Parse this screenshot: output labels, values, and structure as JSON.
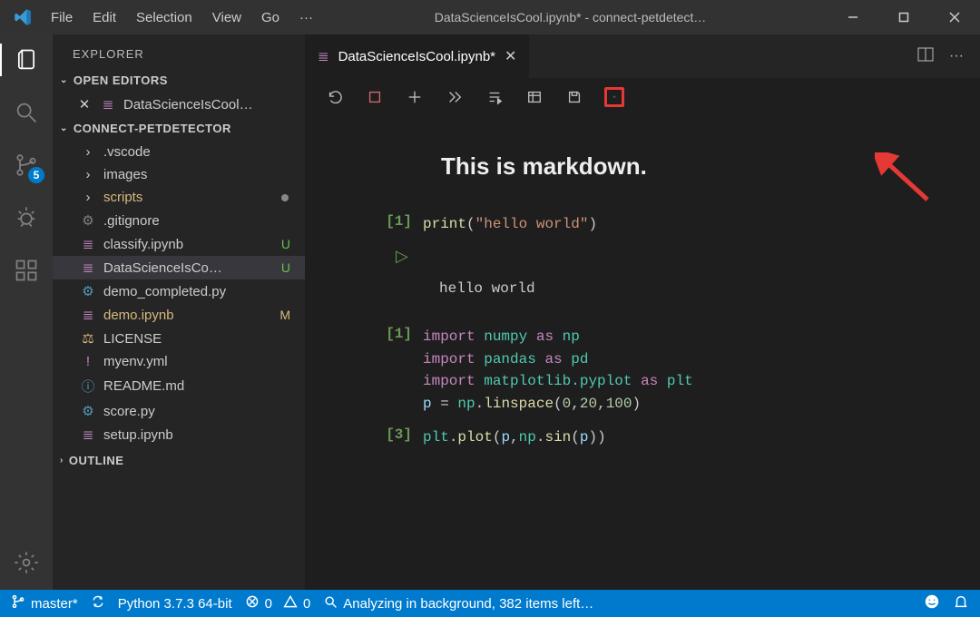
{
  "titlebar": {
    "menus": [
      "File",
      "Edit",
      "Selection",
      "View",
      "Go",
      "···"
    ],
    "title": "DataScienceIsCool.ipynb* - connect-petdetect…"
  },
  "activity": {
    "source_control_badge": "5"
  },
  "explorer": {
    "title": "EXPLORER",
    "open_editors_label": "OPEN EDITORS",
    "open_editors": [
      {
        "name": "DataScienceIsCool…",
        "icon": "notebook"
      }
    ],
    "workspace_label": "CONNECT-PETDETECTOR",
    "tree": [
      {
        "name": ".vscode",
        "type": "folder"
      },
      {
        "name": "images",
        "type": "folder"
      },
      {
        "name": "scripts",
        "type": "folder",
        "accent": true,
        "dirty": true
      },
      {
        "name": ".gitignore",
        "type": "file",
        "icon": "git"
      },
      {
        "name": "classify.ipynb",
        "type": "file",
        "icon": "notebook",
        "tail": "U",
        "tailColor": "green"
      },
      {
        "name": "DataScienceIsCo…",
        "type": "file",
        "icon": "notebook",
        "tail": "U",
        "tailColor": "green",
        "active": true
      },
      {
        "name": "demo_completed.py",
        "type": "file",
        "icon": "py"
      },
      {
        "name": "demo.ipynb",
        "type": "file",
        "icon": "notebook",
        "accent": true,
        "tail": "M",
        "tailColor": "yellow"
      },
      {
        "name": "LICENSE",
        "type": "file",
        "icon": "lic"
      },
      {
        "name": "myenv.yml",
        "type": "file",
        "icon": "yml"
      },
      {
        "name": "README.md",
        "type": "file",
        "icon": "md"
      },
      {
        "name": "score.py",
        "type": "file",
        "icon": "py"
      },
      {
        "name": "setup.ipynb",
        "type": "file",
        "icon": "notebook"
      }
    ],
    "outline_label": "OUTLINE"
  },
  "editor": {
    "tab_label": "DataScienceIsCool.ipynb*",
    "markdown_heading": "This is markdown.",
    "cells": [
      {
        "prompt": "[1]",
        "kind": "code",
        "code_html": "<span class='fn'>print</span>(<span class='str'>\"hello world\"</span>)"
      },
      {
        "prompt": "",
        "kind": "output",
        "text": "hello world"
      },
      {
        "prompt": "[1]",
        "kind": "code",
        "code_html": "<span class='kw'>import</span> <span class='lib'>numpy</span> <span class='kw'>as</span> <span class='lib'>np</span>\n<span class='kw'>import</span> <span class='lib'>pandas</span> <span class='kw'>as</span> <span class='lib'>pd</span>\n<span class='kw'>import</span> <span class='lib'>matplotlib.pyplot</span> <span class='kw'>as</span> <span class='lib'>plt</span>\n<span class='var'>p</span> = <span class='lib'>np</span>.<span class='fn'>linspace</span>(<span class='num'>0</span>,<span class='num'>20</span>,<span class='num'>100</span>)"
      },
      {
        "prompt": "[3]",
        "kind": "code",
        "code_html": "<span class='lib'>plt</span>.<span class='fn'>plot</span>(<span class='var'>p</span>,<span class='lib'>np</span>.<span class='fn'>sin</span>(<span class='var'>p</span>))"
      }
    ]
  },
  "statusbar": {
    "branch": "master*",
    "python": "Python 3.7.3 64-bit",
    "errors": "0",
    "warnings": "0",
    "analyzing": "Analyzing in background, 382 items left…"
  }
}
